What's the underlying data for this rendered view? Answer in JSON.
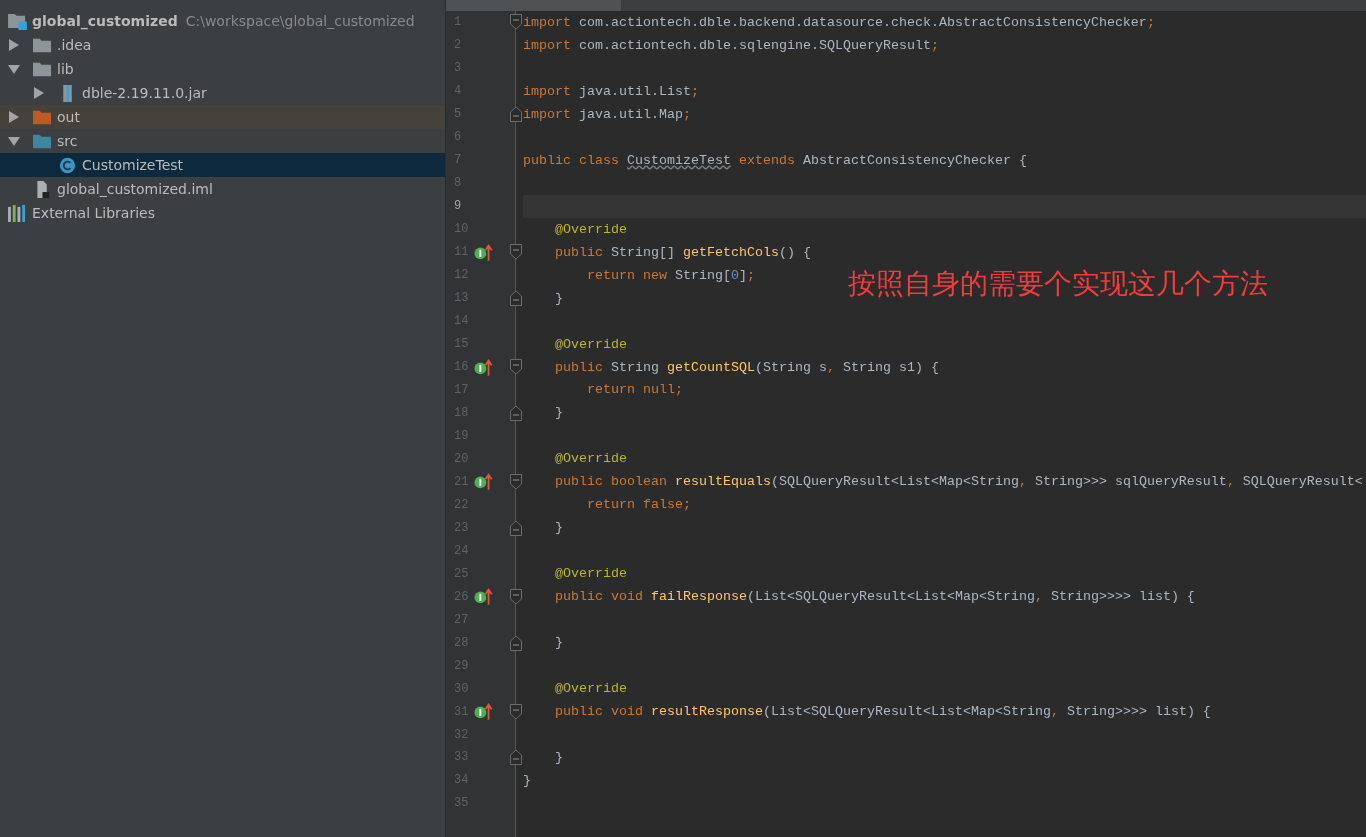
{
  "project_tree": [
    {
      "label": "global_customized",
      "path": "C:\\workspace\\global_customized",
      "kind": "project",
      "selected": false
    },
    {
      "label": ".idea",
      "kind": "folder",
      "expanded": false,
      "selected": false
    },
    {
      "label": "lib",
      "kind": "folder",
      "expanded": true,
      "selected": false,
      "children": [
        {
          "label": "dble-2.19.11.0.jar",
          "kind": "jar",
          "expanded": false,
          "selected": false
        }
      ]
    },
    {
      "label": "out",
      "kind": "excluded",
      "expanded": false,
      "selected": false
    },
    {
      "label": "src",
      "kind": "source",
      "expanded": true,
      "selected": false,
      "children": [
        {
          "label": "CustomizeTest",
          "kind": "class",
          "selected": true
        }
      ]
    },
    {
      "label": "global_customized.iml",
      "kind": "file",
      "selected": false
    },
    {
      "label": "External Libraries",
      "kind": "libraries",
      "selected": false
    }
  ],
  "editor": {
    "lines": [
      {
        "n": "1",
        "kind": "fold-start",
        "current": false,
        "marker": false,
        "tokens": [
          {
            "kind": "kw",
            "text": "import"
          },
          {
            "kind": "p",
            "text": " com.actiontech.dble.backend.datasource.check.AbstractConsistencyChecker"
          },
          {
            "kind": "kw",
            "text": ";"
          }
        ]
      },
      {
        "n": "2",
        "kind": "plain",
        "current": false,
        "marker": false,
        "tokens": [
          {
            "kind": "kw",
            "text": "import"
          },
          {
            "kind": "p",
            "text": " com.actiontech.dble.sqlengine.SQLQueryResult"
          },
          {
            "kind": "kw",
            "text": ";"
          }
        ]
      },
      {
        "n": "3",
        "kind": "plain",
        "current": false,
        "marker": false
      },
      {
        "n": "4",
        "kind": "plain",
        "current": false,
        "marker": false,
        "tokens": [
          {
            "kind": "kw",
            "text": "import"
          },
          {
            "kind": "p",
            "text": " java.util.List"
          },
          {
            "kind": "kw",
            "text": ";"
          }
        ]
      },
      {
        "n": "5",
        "kind": "fold-end",
        "current": false,
        "marker": false,
        "tokens": [
          {
            "kind": "kw",
            "text": "import"
          },
          {
            "kind": "p",
            "text": " java.util.Map"
          },
          {
            "kind": "kw",
            "text": ";"
          }
        ]
      },
      {
        "n": "6",
        "kind": "plain",
        "current": false,
        "marker": false
      },
      {
        "n": "7",
        "kind": "plain",
        "current": false,
        "marker": false,
        "tokens": [
          {
            "kind": "kw",
            "text": "public class "
          },
          {
            "kind": "warn",
            "text": "CustomizeTest"
          },
          {
            "kind": "kw",
            "text": " extends "
          },
          {
            "kind": "p",
            "text": "AbstractConsistencyChecker {"
          }
        ]
      },
      {
        "n": "8",
        "kind": "plain",
        "current": false,
        "marker": false
      },
      {
        "n": "9",
        "kind": "plain",
        "current": true,
        "marker": false
      },
      {
        "n": "10",
        "kind": "plain",
        "current": false,
        "marker": false,
        "tokens": [
          {
            "kind": "ann",
            "text": "    @Override"
          }
        ]
      },
      {
        "n": "11",
        "kind": "fold-start",
        "current": false,
        "marker": true,
        "tokens": [
          {
            "kind": "kw",
            "text": "    public "
          },
          {
            "kind": "p",
            "text": "String[] "
          },
          {
            "kind": "fn",
            "text": "getFetchCols"
          },
          {
            "kind": "p",
            "text": "() {"
          }
        ]
      },
      {
        "n": "12",
        "kind": "plain",
        "current": false,
        "marker": false,
        "tokens": [
          {
            "kind": "kw",
            "text": "        return new "
          },
          {
            "kind": "p",
            "text": "String["
          },
          {
            "kind": "num",
            "text": "0"
          },
          {
            "kind": "p",
            "text": "]"
          },
          {
            "kind": "kw",
            "text": ";"
          }
        ]
      },
      {
        "n": "13",
        "kind": "fold-end",
        "current": false,
        "marker": false,
        "tokens": [
          {
            "kind": "p",
            "text": "    }"
          }
        ]
      },
      {
        "n": "14",
        "kind": "plain",
        "current": false,
        "marker": false
      },
      {
        "n": "15",
        "kind": "plain",
        "current": false,
        "marker": false,
        "tokens": [
          {
            "kind": "ann",
            "text": "    @Override"
          }
        ]
      },
      {
        "n": "16",
        "kind": "fold-start",
        "current": false,
        "marker": true,
        "tokens": [
          {
            "kind": "kw",
            "text": "    public "
          },
          {
            "kind": "p",
            "text": "String "
          },
          {
            "kind": "fn",
            "text": "getCountSQL"
          },
          {
            "kind": "p",
            "text": "(String s"
          },
          {
            "kind": "kw",
            "text": ","
          },
          {
            "kind": "p",
            "text": " String s1) {"
          }
        ]
      },
      {
        "n": "17",
        "kind": "plain",
        "current": false,
        "marker": false,
        "tokens": [
          {
            "kind": "kw",
            "text": "        return null;"
          }
        ]
      },
      {
        "n": "18",
        "kind": "fold-end",
        "current": false,
        "marker": false,
        "tokens": [
          {
            "kind": "p",
            "text": "    }"
          }
        ]
      },
      {
        "n": "19",
        "kind": "plain",
        "current": false,
        "marker": false
      },
      {
        "n": "20",
        "kind": "plain",
        "current": false,
        "marker": false,
        "tokens": [
          {
            "kind": "ann",
            "text": "    @Override"
          }
        ]
      },
      {
        "n": "21",
        "kind": "fold-start",
        "current": false,
        "marker": true,
        "tokens": [
          {
            "kind": "kw",
            "text": "    public boolean "
          },
          {
            "kind": "fn",
            "text": "resultEquals"
          },
          {
            "kind": "p",
            "text": "(SQLQueryResult<List<Map<String"
          },
          {
            "kind": "kw",
            "text": ","
          },
          {
            "kind": "p",
            "text": " String>>> sqlQueryResult"
          },
          {
            "kind": "kw",
            "text": ","
          },
          {
            "kind": "p",
            "text": " SQLQueryResult<"
          }
        ]
      },
      {
        "n": "22",
        "kind": "plain",
        "current": false,
        "marker": false,
        "tokens": [
          {
            "kind": "kw",
            "text": "        return false;"
          }
        ]
      },
      {
        "n": "23",
        "kind": "fold-end",
        "current": false,
        "marker": false,
        "tokens": [
          {
            "kind": "p",
            "text": "    }"
          }
        ]
      },
      {
        "n": "24",
        "kind": "plain",
        "current": false,
        "marker": false
      },
      {
        "n": "25",
        "kind": "plain",
        "current": false,
        "marker": false,
        "tokens": [
          {
            "kind": "ann",
            "text": "    @Override"
          }
        ]
      },
      {
        "n": "26",
        "kind": "fold-start",
        "current": false,
        "marker": true,
        "tokens": [
          {
            "kind": "kw",
            "text": "    public void "
          },
          {
            "kind": "fn",
            "text": "failResponse"
          },
          {
            "kind": "p",
            "text": "(List<SQLQueryResult<List<Map<String"
          },
          {
            "kind": "kw",
            "text": ","
          },
          {
            "kind": "p",
            "text": " String>>>> list) {"
          }
        ]
      },
      {
        "n": "27",
        "kind": "plain",
        "current": false,
        "marker": false
      },
      {
        "n": "28",
        "kind": "fold-end",
        "current": false,
        "marker": false,
        "tokens": [
          {
            "kind": "p",
            "text": "    }"
          }
        ]
      },
      {
        "n": "29",
        "kind": "plain",
        "current": false,
        "marker": false
      },
      {
        "n": "30",
        "kind": "plain",
        "current": false,
        "marker": false,
        "tokens": [
          {
            "kind": "ann",
            "text": "    @Override"
          }
        ]
      },
      {
        "n": "31",
        "kind": "fold-start",
        "current": false,
        "marker": true,
        "tokens": [
          {
            "kind": "kw",
            "text": "    public void "
          },
          {
            "kind": "fn",
            "text": "resultResponse"
          },
          {
            "kind": "p",
            "text": "(List<SQLQueryResult<List<Map<String"
          },
          {
            "kind": "kw",
            "text": ","
          },
          {
            "kind": "p",
            "text": " String>>>> list) {"
          }
        ]
      },
      {
        "n": "32",
        "kind": "plain",
        "current": false,
        "marker": false
      },
      {
        "n": "33",
        "kind": "fold-end",
        "current": false,
        "marker": false,
        "tokens": [
          {
            "kind": "p",
            "text": "    }"
          }
        ]
      },
      {
        "n": "34",
        "kind": "plain",
        "current": false,
        "marker": false,
        "tokens": [
          {
            "kind": "p",
            "text": "}"
          }
        ]
      },
      {
        "n": "35",
        "kind": "plain",
        "current": false,
        "marker": false
      }
    ]
  },
  "annotation": "按照自身的需要个实现这几个方法"
}
